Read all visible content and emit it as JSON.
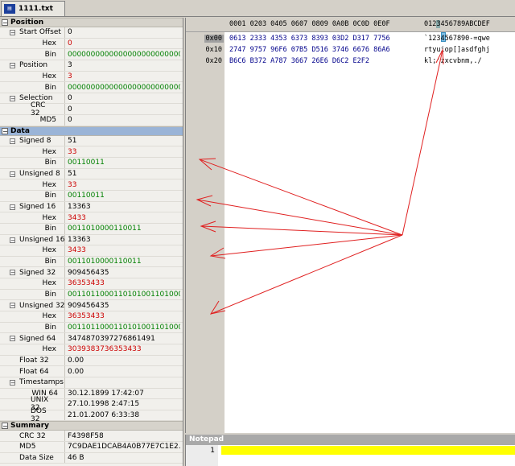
{
  "tab": {
    "icon": "file-icon",
    "label": "1111.txt"
  },
  "panel": {
    "sections": [
      {
        "title": "Position"
      },
      {
        "title": "Data"
      },
      {
        "title": "Summary"
      }
    ],
    "position": {
      "start_offset": {
        "label": "Start Offset",
        "value": "0",
        "hex_label": "Hex",
        "hex": "0",
        "bin_label": "Bin",
        "bin": "00000000000000000000000000..."
      },
      "position": {
        "label": "Position",
        "value": "3",
        "hex_label": "Hex",
        "hex": "3",
        "bin_label": "Bin",
        "bin": "00000000000000000000000000..."
      },
      "selection": {
        "label": "Selection",
        "value": "0",
        "crc_label": "CRC 32",
        "crc": "0",
        "md5_label": "MD5",
        "md5": "0"
      }
    },
    "data": [
      {
        "label": "Signed 8",
        "value": "51",
        "hex": "33",
        "bin": "00110011"
      },
      {
        "label": "Unsigned 8",
        "value": "51",
        "hex": "33",
        "bin": "00110011"
      },
      {
        "label": "Signed 16",
        "value": "13363",
        "hex": "3433",
        "bin": "0011010000110011"
      },
      {
        "label": "Unsigned 16",
        "value": "13363",
        "hex": "3433",
        "bin": "0011010000110011"
      },
      {
        "label": "Signed 32",
        "value": "909456435",
        "hex": "36353433",
        "bin": "00110110001101010011010000..."
      },
      {
        "label": "Unsigned 32",
        "value": "909456435",
        "hex": "36353433",
        "bin": "00110110001101010011010000..."
      },
      {
        "label": "Signed 64",
        "value": "3474870397276861491",
        "hex": "3039383736353433"
      }
    ],
    "hex_label": "Hex",
    "bin_label": "Bin",
    "floats": [
      {
        "label": "Float 32",
        "value": "0.00"
      },
      {
        "label": "Float 64",
        "value": "0.00"
      }
    ],
    "timestamps": {
      "label": "Timestamps",
      "items": [
        {
          "label": "WIN 64",
          "value": "30.12.1899 17:42:07"
        },
        {
          "label": "UNIX 32",
          "value": "27.10.1998 2:47:15"
        },
        {
          "label": "DOS 32",
          "value": "21.01.2007 6:33:38"
        }
      ]
    },
    "summary": [
      {
        "label": "CRC 32",
        "value": "F4398F58"
      },
      {
        "label": "MD5",
        "value": "7C9DAE1DCAB4A0B77E7C1E2..."
      },
      {
        "label": "Data Size",
        "value": "46 B"
      }
    ]
  },
  "hexview": {
    "header": "0001 0203 0405 0607 0809 0A0B 0C0D 0E0F",
    "ascii_header_pre": "012",
    "ascii_header_cur": "3",
    "ascii_header_post": "456789ABCDEF",
    "offsets": [
      "0x00",
      "0x10",
      "0x20"
    ],
    "hex_rows": [
      "0613 2333 4353 6373 8393 03D2 D317 7756",
      "2747 9757 96F6 07B5 D516 3746 6676 86A6",
      "B6C6 B372 A787 3667 26E6 D6C2 E2F2"
    ],
    "ascii_rows": [
      "`1234567890-=qwe",
      "rtyuiop[]asdfghj",
      "kl;'zxcvbnm,./"
    ]
  },
  "notepad": {
    "title": "Notepad",
    "line_number": "1"
  },
  "colors": {
    "accent_red": "#cc0000",
    "accent_green": "#008000",
    "hex_blue": "#00008b",
    "arrow": "#e02020",
    "notepad_highlight": "#ffff00"
  }
}
